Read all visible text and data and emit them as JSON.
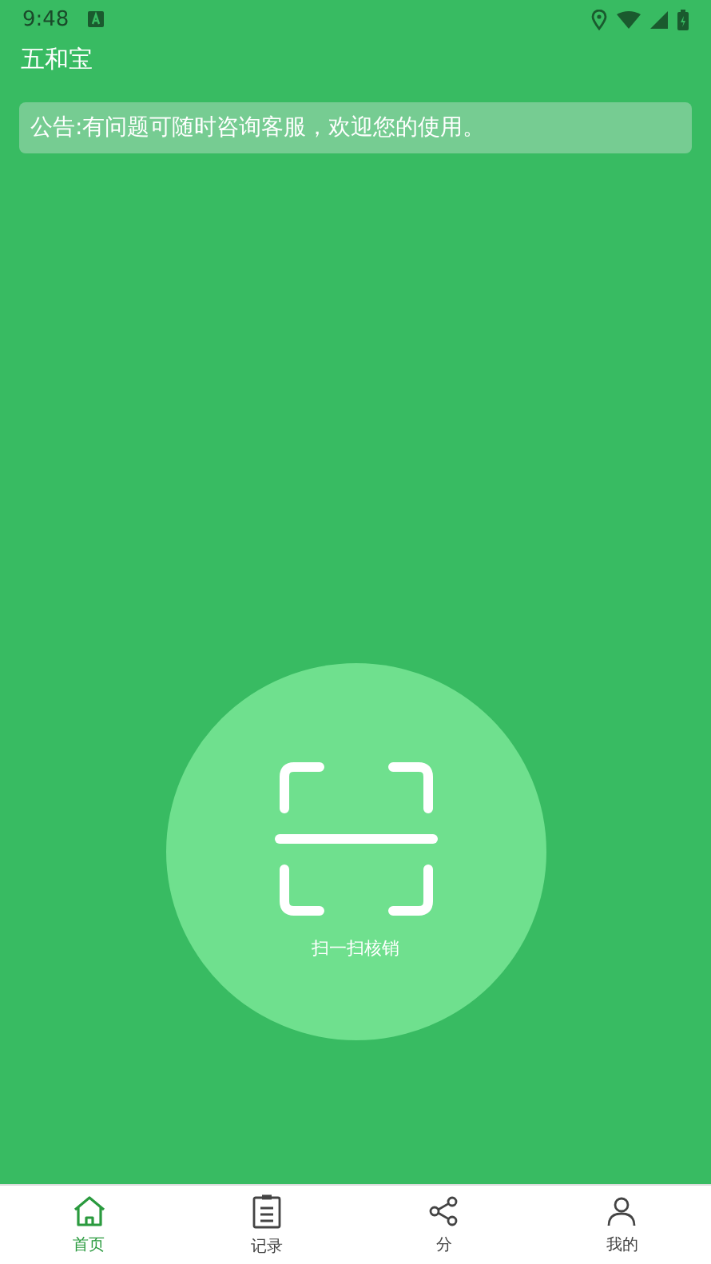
{
  "status_bar": {
    "time": "9:48"
  },
  "app_title": "五和宝",
  "notice": "公告:有问题可随时咨询客服，欢迎您的使用。",
  "scan_button": {
    "label": "扫一扫核销"
  },
  "tab_bar": [
    {
      "kind": "home",
      "label": "首页",
      "selected": true
    },
    {
      "kind": "records",
      "label": "记录",
      "selected": false
    },
    {
      "kind": "share",
      "label": "分",
      "selected": false
    },
    {
      "kind": "profile",
      "label": "我的",
      "selected": false
    }
  ]
}
